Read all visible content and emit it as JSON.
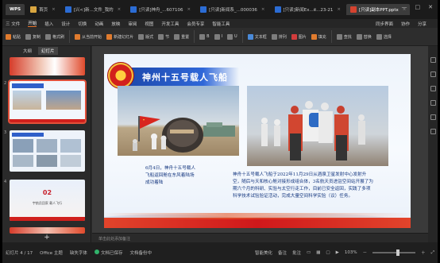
{
  "tabs": [
    {
      "label": "WPS",
      "kind": "wps"
    },
    {
      "label": "首页",
      "icon_color": "#d9a640"
    },
    {
      "label": "[兴<]新...文件_我的",
      "icon_color": "#2b6cd4"
    },
    {
      "label": "[只读]神舟_...607106",
      "icon_color": "#2b6cd4"
    },
    {
      "label": "[只读]新闻系_...000036",
      "icon_color": "#2b6cd4"
    },
    {
      "label": "[只读]新闻Ex...ё...23-21",
      "icon_color": "#2b6cd4"
    },
    {
      "label": "[只读]副本PPT.pptx",
      "icon_color": "#d5432f",
      "active": true
    }
  ],
  "menu": [
    "三 文件",
    "开始",
    "插入",
    "设计",
    "切换",
    "动画",
    "放映",
    "审阅",
    "视图",
    "开发工具",
    "会员专享",
    "智能工具"
  ],
  "menu_active": "开始",
  "menu_right": [
    "同步界面",
    "协作",
    "分享"
  ],
  "toolbar": [
    "粘贴",
    "复制",
    "格式刷",
    "从当前开始",
    "新建幻灯片",
    "版式",
    "节",
    "重置",
    "B",
    "I",
    "U",
    "文本框",
    "排列",
    "图片",
    "填充",
    "查找",
    "替换",
    "选择"
  ],
  "panel_tabs": [
    "大纲",
    "幻灯片"
  ],
  "panel_tab_active": "幻灯片",
  "thumbs": [
    {
      "num": "1"
    },
    {
      "num": "2"
    },
    {
      "num": "3"
    },
    {
      "num": "4",
      "text": "02",
      "sub": "宇航员回家  载人飞行"
    }
  ],
  "slide": {
    "title": "神州十五号载人飞船",
    "caption_left": "6月4日，神舟十五号载人飞船返回舱在东风着陆场成功着陆",
    "caption_right": "神舟十五号载人飞船于2022年11月29日从酒泉卫星发射中心发射升空，随后与天和核心舱对接形成组合体，3名航天员进驻空间站开展了为期六个月的科研、实验与太空行走工作，目前已安全返回，实践了多项科学技术试验验证活动，完成大量空间科学实验（议）任务。"
  },
  "notes_placeholder": "单击此处添加备注",
  "status": {
    "slide_count": "幻灯片 4 / 17",
    "theme": "Office 主题",
    "font": "缺失字体",
    "doc_state": "文档已保存",
    "protect": "文档备份中",
    "smart": "智能美化",
    "notes": "备注",
    "comments": "批注",
    "zoom": "103%"
  }
}
